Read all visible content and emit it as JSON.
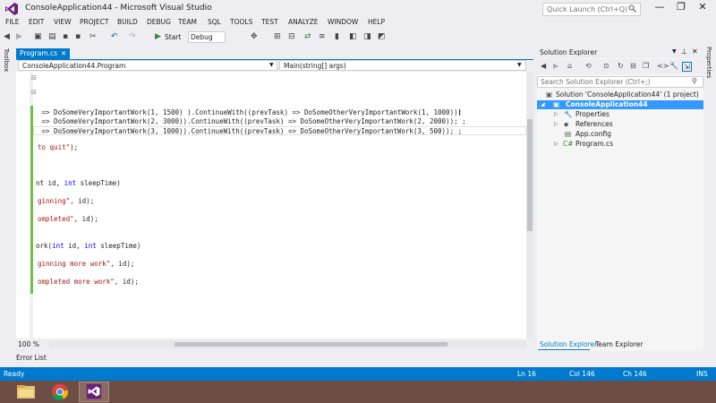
{
  "window": {
    "title": "ConsoleApplication44 - Microsoft Visual Studio",
    "quick_launch_placeholder": "Quick Launch (Ctrl+Q)",
    "buttons": {
      "minimize": "—",
      "restore": "❐",
      "close": "✕"
    }
  },
  "menu": [
    "FILE",
    "EDIT",
    "VIEW",
    "PROJECT",
    "BUILD",
    "DEBUG",
    "TEAM",
    "SQL",
    "TOOLS",
    "TEST",
    "ANALYZE",
    "WINDOW",
    "HELP"
  ],
  "toolbar": {
    "start_label": "Start",
    "configuration": "Debug"
  },
  "toolbox_label": "Toolbox",
  "properties_label": "Properties",
  "editor": {
    "tab_label": "Program.cs",
    "nav_class": "ConsoleApplication44.Program",
    "nav_member": "Main(string[] args)",
    "zoom": "100 %",
    "lines": {
      "l1_a": " => DoSomeVeryImportantWork(1, 1500) ).ContinueWith((prevTask) => DoSomeOtherVeryImportantWork(1, 1000));",
      "l2_a": " => DoSomeVeryImportantWork(2, 3000)).ContinueWith((prevTask) => DoSomeOtherVeryImportantWork(2, 2000)); ;",
      "l3_a": " => DoSomeVeryImportantWork(3, 1000)).ContinueWith((prevTask) => DoSomeOtherVeryImportantWork(3, 500)); ;",
      "l4_str": "to quit\"",
      "l4_rest": ");",
      "l5_a": "nt id, ",
      "l5_kw": "int",
      "l5_b": " sleepTime)",
      "l6_str": "ginning\"",
      "l6_rest": ", id);",
      "l7_str": "ompleted\"",
      "l7_rest": ", id);",
      "l8_a": "ork(",
      "l8_kw1": "int",
      "l8_b": " id, ",
      "l8_kw2": "int",
      "l8_c": " sleepTime)",
      "l9_str": "ginning more work\"",
      "l9_rest": ", id);",
      "l10_str": "ompleted more work\"",
      "l10_rest": ", id);"
    }
  },
  "error_list_label": "Error List",
  "solution_explorer": {
    "title": "Solution Explorer",
    "search_placeholder": "Search Solution Explorer (Ctrl+;)",
    "tree": [
      {
        "label": "Solution 'ConsoleApplication44' (1 project)"
      },
      {
        "label": "ConsoleApplication44"
      },
      {
        "label": "Properties"
      },
      {
        "label": "References"
      },
      {
        "label": "App.config"
      },
      {
        "label": "Program.cs"
      }
    ],
    "bottom_tabs": [
      "Solution Explorer",
      "Team Explorer"
    ]
  },
  "status": {
    "ready": "Ready",
    "line": "Ln 16",
    "col": "Col 146",
    "ch": "Ch 146",
    "mode": "INS"
  },
  "colors": {
    "accent": "#007acc",
    "change_bar": "#6cc24a",
    "string": "#a31515",
    "keyword": "#0000ff"
  }
}
